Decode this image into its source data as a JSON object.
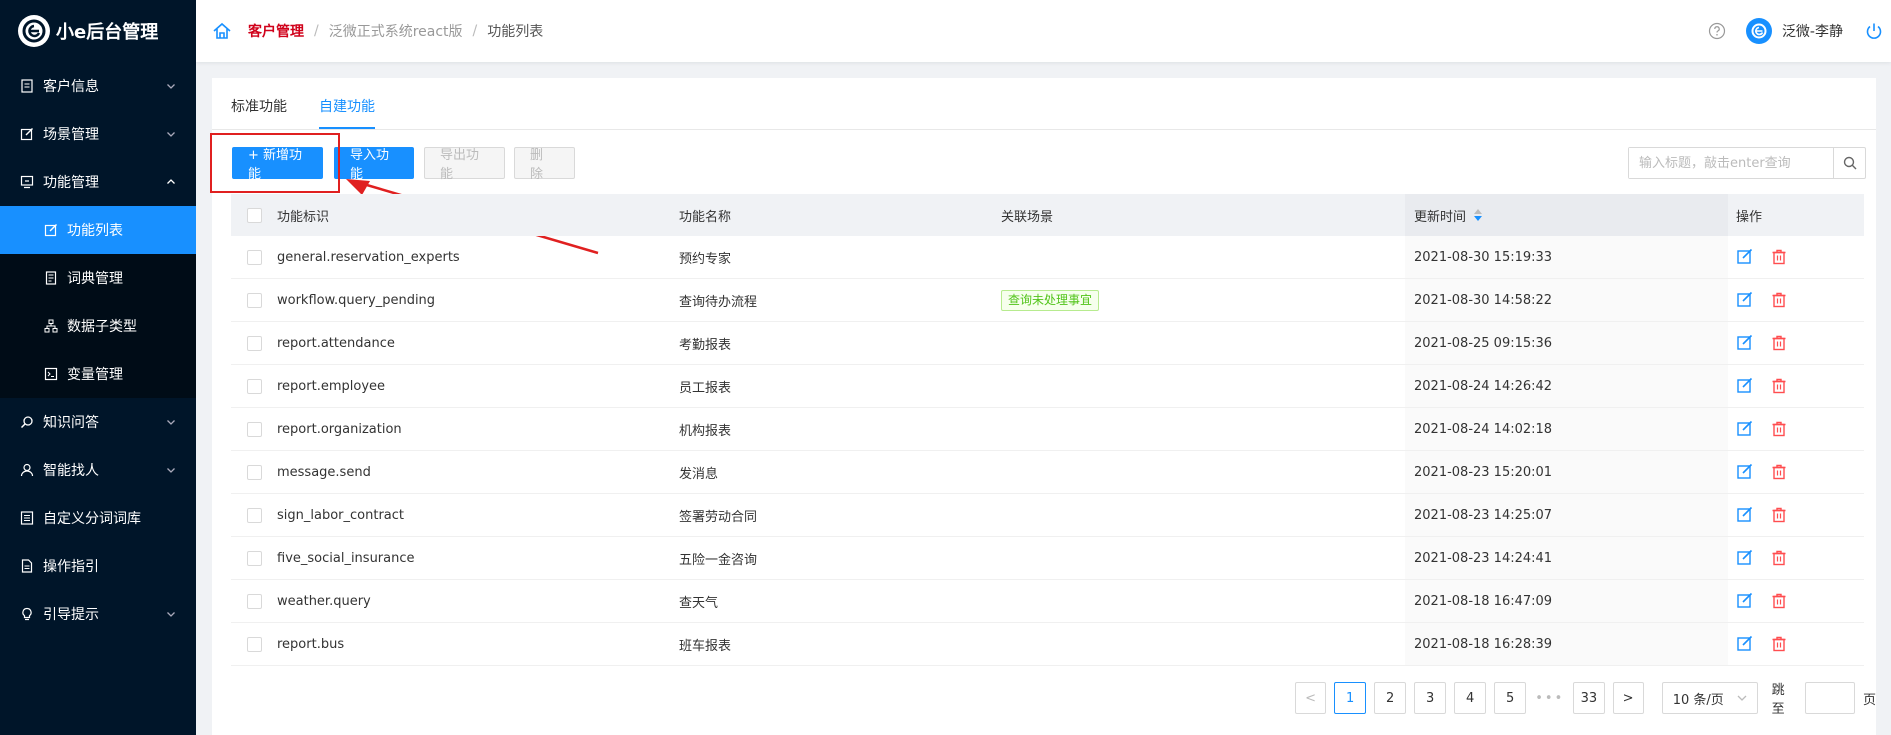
{
  "app": {
    "title": "小e后台管理"
  },
  "sidebar": {
    "items": [
      {
        "label": "客户信息",
        "icon": "document-icon",
        "chevron": "down"
      },
      {
        "label": "场景管理",
        "icon": "edit-icon",
        "chevron": "down"
      },
      {
        "label": "功能管理",
        "icon": "monitor-icon",
        "chevron": "up"
      },
      {
        "label": "功能列表",
        "icon": "edit-icon",
        "sub": true,
        "active": true
      },
      {
        "label": "词典管理",
        "icon": "book-icon",
        "sub": true
      },
      {
        "label": "数据子类型",
        "icon": "hierarchy-icon",
        "sub": true
      },
      {
        "label": "变量管理",
        "icon": "terminal-icon",
        "sub": true
      },
      {
        "label": "知识问答",
        "icon": "search-icon",
        "chevron": "down"
      },
      {
        "label": "智能找人",
        "icon": "user-icon",
        "chevron": "down"
      },
      {
        "label": "自定义分词词库",
        "icon": "list-icon"
      },
      {
        "label": "操作指引",
        "icon": "file-icon"
      },
      {
        "label": "引导提示",
        "icon": "bulb-icon",
        "chevron": "down"
      }
    ]
  },
  "header": {
    "breadcrumb": [
      "客户管理",
      "泛微正式系统react版",
      "功能列表"
    ],
    "separator": "/",
    "username": "泛微-李静"
  },
  "tabs": [
    {
      "label": "标准功能",
      "active": false
    },
    {
      "label": "自建功能",
      "active": true
    }
  ],
  "toolbar": {
    "add_label": "+ 新增功能",
    "import_label": "导入功能",
    "export_label": "导出功能",
    "delete_label": "删 除",
    "search_placeholder": "输入标题，敲击enter查询"
  },
  "table": {
    "columns": [
      "功能标识",
      "功能名称",
      "关联场景",
      "更新时间",
      "操作"
    ],
    "rows": [
      {
        "id": "general.reservation_experts",
        "name": "预约专家",
        "scene": "",
        "time": "2021-08-30 15:19:33"
      },
      {
        "id": "workflow.query_pending",
        "name": "查询待办流程",
        "scene": "查询未处理事宜",
        "time": "2021-08-30 14:58:22"
      },
      {
        "id": "report.attendance",
        "name": "考勤报表",
        "scene": "",
        "time": "2021-08-25 09:15:36"
      },
      {
        "id": "report.employee",
        "name": "员工报表",
        "scene": "",
        "time": "2021-08-24 14:26:42"
      },
      {
        "id": "report.organization",
        "name": "机构报表",
        "scene": "",
        "time": "2021-08-24 14:02:18"
      },
      {
        "id": "message.send",
        "name": "发消息",
        "scene": "",
        "time": "2021-08-23 15:20:01"
      },
      {
        "id": "sign_labor_contract",
        "name": "签署劳动合同",
        "scene": "",
        "time": "2021-08-23 14:25:07"
      },
      {
        "id": "five_social_insurance",
        "name": "五险一金咨询",
        "scene": "",
        "time": "2021-08-23 14:24:41"
      },
      {
        "id": "weather.query",
        "name": "查天气",
        "scene": "",
        "time": "2021-08-18 16:47:09"
      },
      {
        "id": "report.bus",
        "name": "班车报表",
        "scene": "",
        "time": "2021-08-18 16:28:39"
      }
    ]
  },
  "pagination": {
    "prev": "<",
    "next": ">",
    "pages": [
      "1",
      "2",
      "3",
      "4",
      "5"
    ],
    "ellipsis": "•••",
    "last_page": "33",
    "current": "1",
    "page_size": "10 条/页",
    "jump_label": "跳至",
    "jump_suffix": "页"
  },
  "colors": {
    "sidebar_bg": "#001529",
    "accent": "#1890ff",
    "annotation": "#e02020",
    "danger": "#ff4d4f",
    "tag_green": "#52c41a"
  }
}
